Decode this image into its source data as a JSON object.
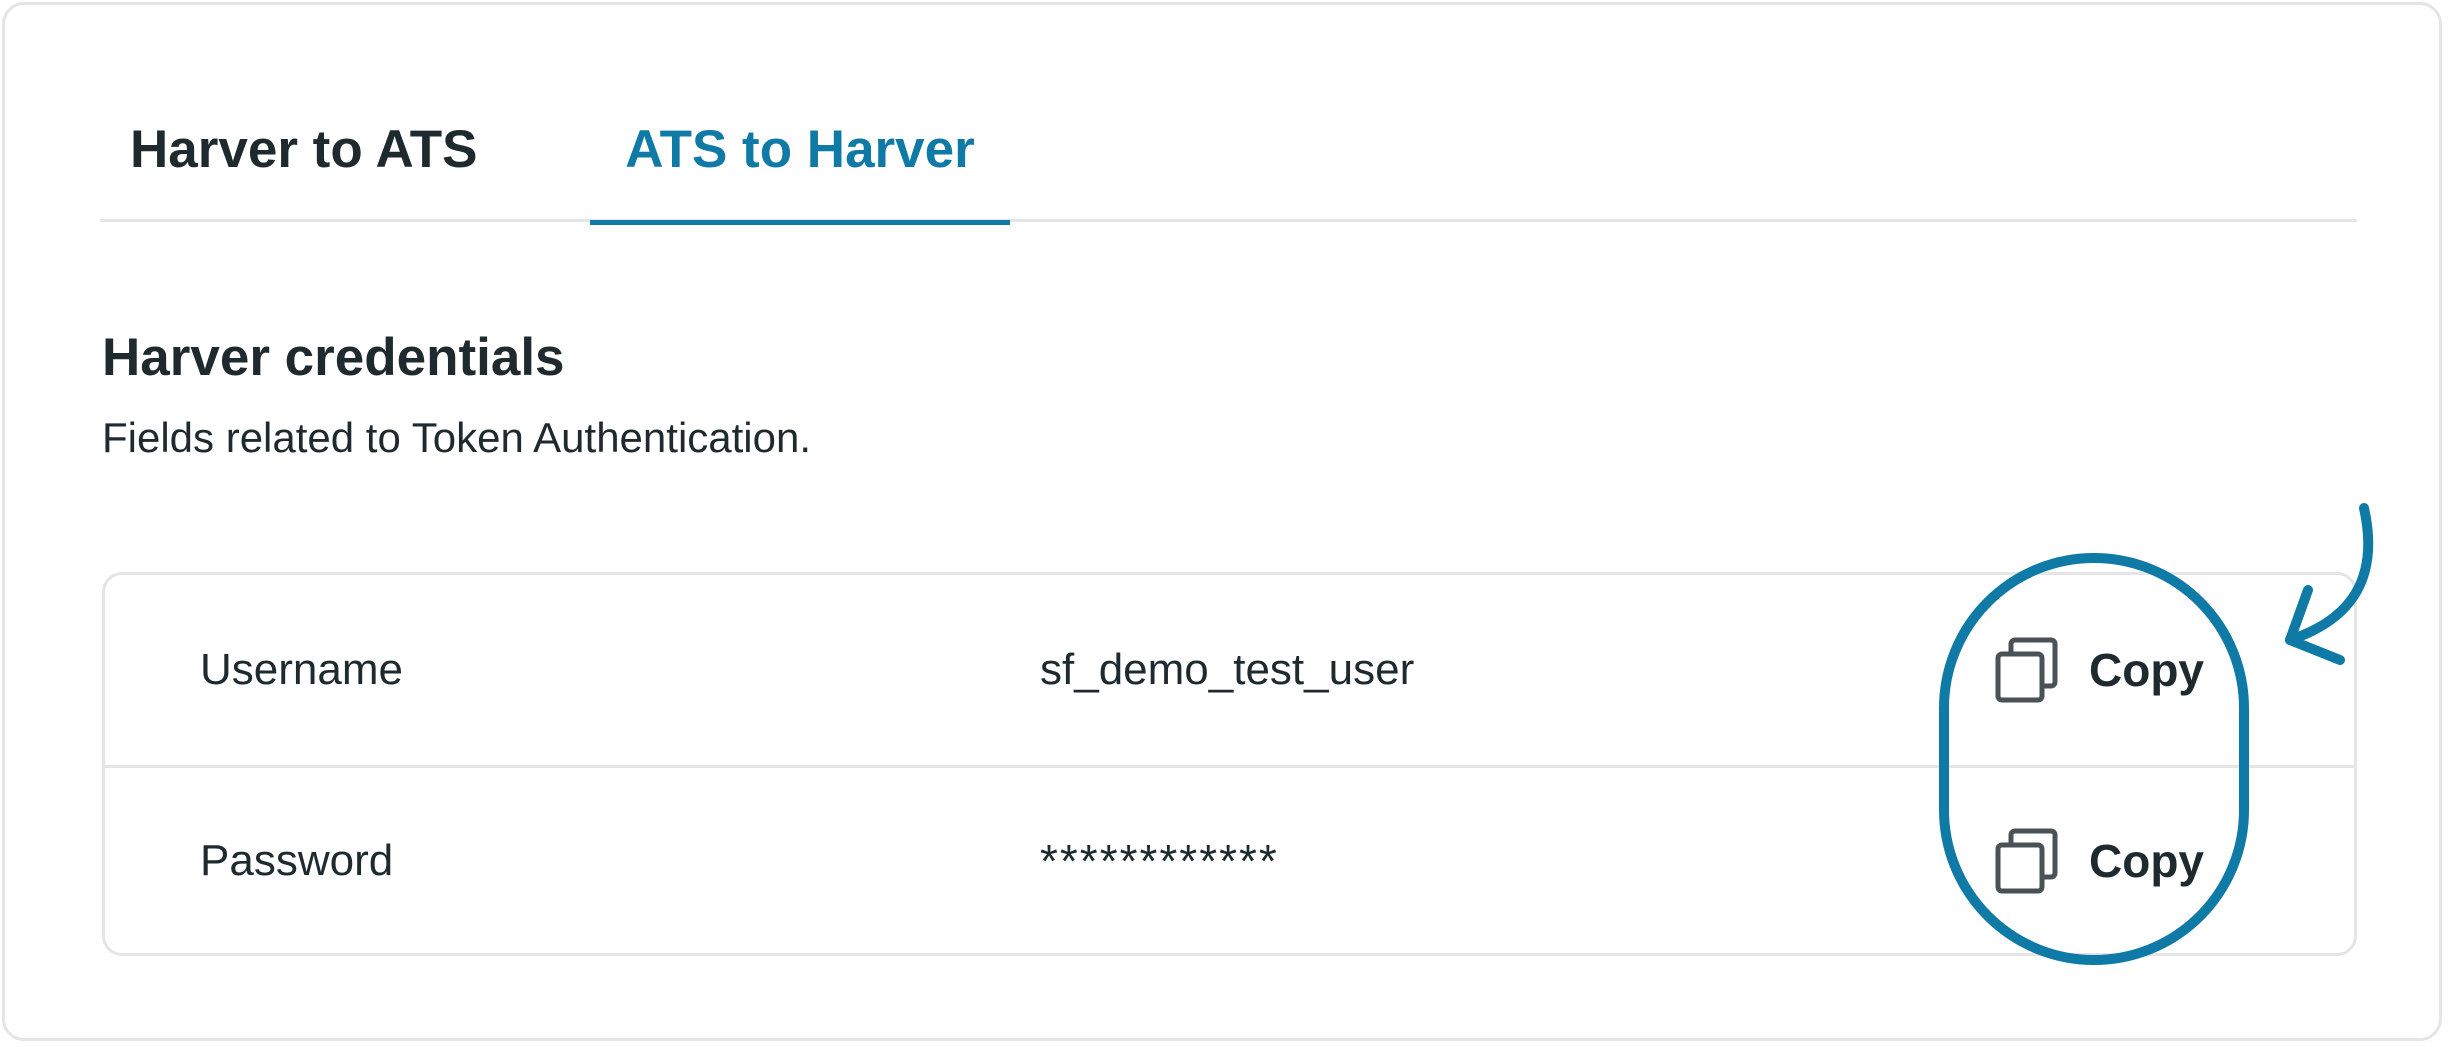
{
  "tabs": [
    {
      "label": "Harver to ATS",
      "active": false
    },
    {
      "label": "ATS to Harver",
      "active": true
    }
  ],
  "section": {
    "title": "Harver credentials",
    "description": "Fields related to Token Authentication."
  },
  "credentials": [
    {
      "label": "Username",
      "value": "sf_demo_test_user",
      "action": "Copy"
    },
    {
      "label": "Password",
      "value": "************",
      "action": "Copy"
    }
  ],
  "colors": {
    "accent": "#0f7aa5",
    "text": "#1f2a2e",
    "border": "#e3e5e6",
    "icon": "#4a5256"
  },
  "icons": {
    "copy": "copy-icon",
    "annotation": "hand-drawn-arrow-icon"
  }
}
